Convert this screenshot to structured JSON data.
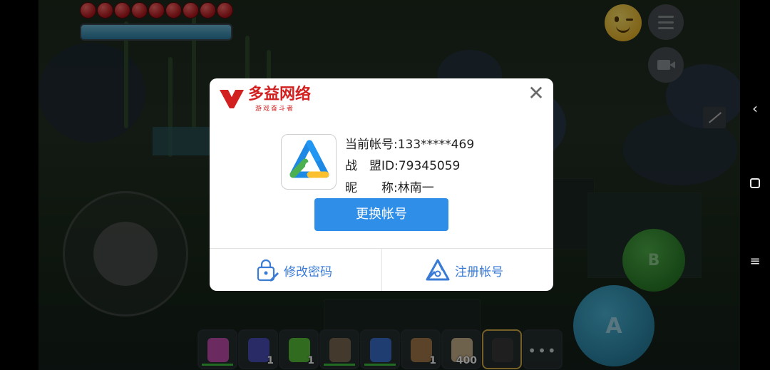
{
  "hud": {
    "hearts": 9,
    "hotbar": [
      {
        "color": "#c54fb0",
        "count": "",
        "bar": true
      },
      {
        "color": "#4a4fb8",
        "count": "1",
        "bar": false
      },
      {
        "color": "#58c43a",
        "count": "1",
        "bar": false
      },
      {
        "color": "#7b6a52",
        "count": "",
        "bar": true
      },
      {
        "color": "#3b70d0",
        "count": "",
        "bar": true
      },
      {
        "color": "#a47a4a",
        "count": "1",
        "bar": false
      },
      {
        "color": "#c9b28a",
        "count": "400",
        "bar": false
      },
      {
        "color": "#3a3a3a",
        "count": "",
        "bar": false,
        "selected": true
      }
    ],
    "more_label": "•••",
    "a_label": "A",
    "b_label": "B"
  },
  "dialog": {
    "brand_name": "多益网络",
    "brand_slogan": "游戏奋斗者",
    "close_label": "✕",
    "account_label": "当前帐号:",
    "account_value": "133*****469",
    "id_label": "战　盟ID:",
    "id_value": "79345059",
    "nick_label": "昵　　称:",
    "nick_value": "林南一",
    "switch_button": "更换帐号",
    "change_password": "修改密码",
    "register": "注册帐号"
  },
  "nav": {
    "back": "‹",
    "recent": "≡"
  },
  "colors": {
    "brand_red": "#d22020",
    "primary_blue": "#2f8ee8",
    "link_blue": "#3a7bd5"
  }
}
